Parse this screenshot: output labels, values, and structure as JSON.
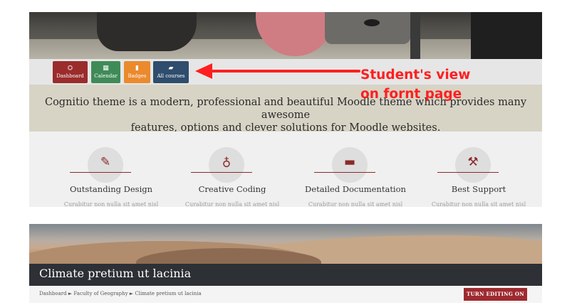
{
  "quick_buttons": [
    {
      "label": "Dashboard",
      "icon": "dashboard-icon",
      "glyph": "⛭",
      "color": "#9b2c2c"
    },
    {
      "label": "Calendar",
      "icon": "calendar-icon",
      "glyph": "▦",
      "color": "#3f8b58"
    },
    {
      "label": "Badges",
      "icon": "bookmark-icon",
      "glyph": "▮",
      "color": "#ea8a2c"
    },
    {
      "label": "All courses",
      "icon": "book-icon",
      "glyph": "▰",
      "color": "#2f4d6c"
    }
  ],
  "welcome": {
    "line1": "Cognitio theme is a modern, professional and beautiful Moodle theme which provides many awesome",
    "line2": "features, options and clever solutions for Moodle websites."
  },
  "features": [
    {
      "title": "Outstanding Design",
      "subtitle": "Curabitur non nulla sit amet nisl",
      "icon": "brush-icon",
      "glyph": "✎"
    },
    {
      "title": "Creative Coding",
      "subtitle": "Curabitur non nulla sit amet nisl",
      "icon": "lightbulb-icon",
      "glyph": "♁"
    },
    {
      "title": "Detailed Documentation",
      "subtitle": "Curabitur non nulla sit amet nisl",
      "icon": "book-open-icon",
      "glyph": "▬"
    },
    {
      "title": "Best Support",
      "subtitle": "Curabitur non nulla sit amet nisl",
      "icon": "wrench-icon",
      "glyph": "⚒"
    }
  ],
  "annotation": {
    "line1": "Student's view",
    "line2": "on fornt page",
    "color": "#ff1f1f"
  },
  "course": {
    "title": "Climate pretium ut lacinia",
    "breadcrumb": "Dashboard ► Faculty of Geography ► Climate pretium ut lacinia",
    "edit_button": "TURN EDITING ON"
  },
  "colors": {
    "accent": "#9b2c2c",
    "welcome_bg": "#d7d4c6",
    "course_bar": "#2d3035"
  }
}
